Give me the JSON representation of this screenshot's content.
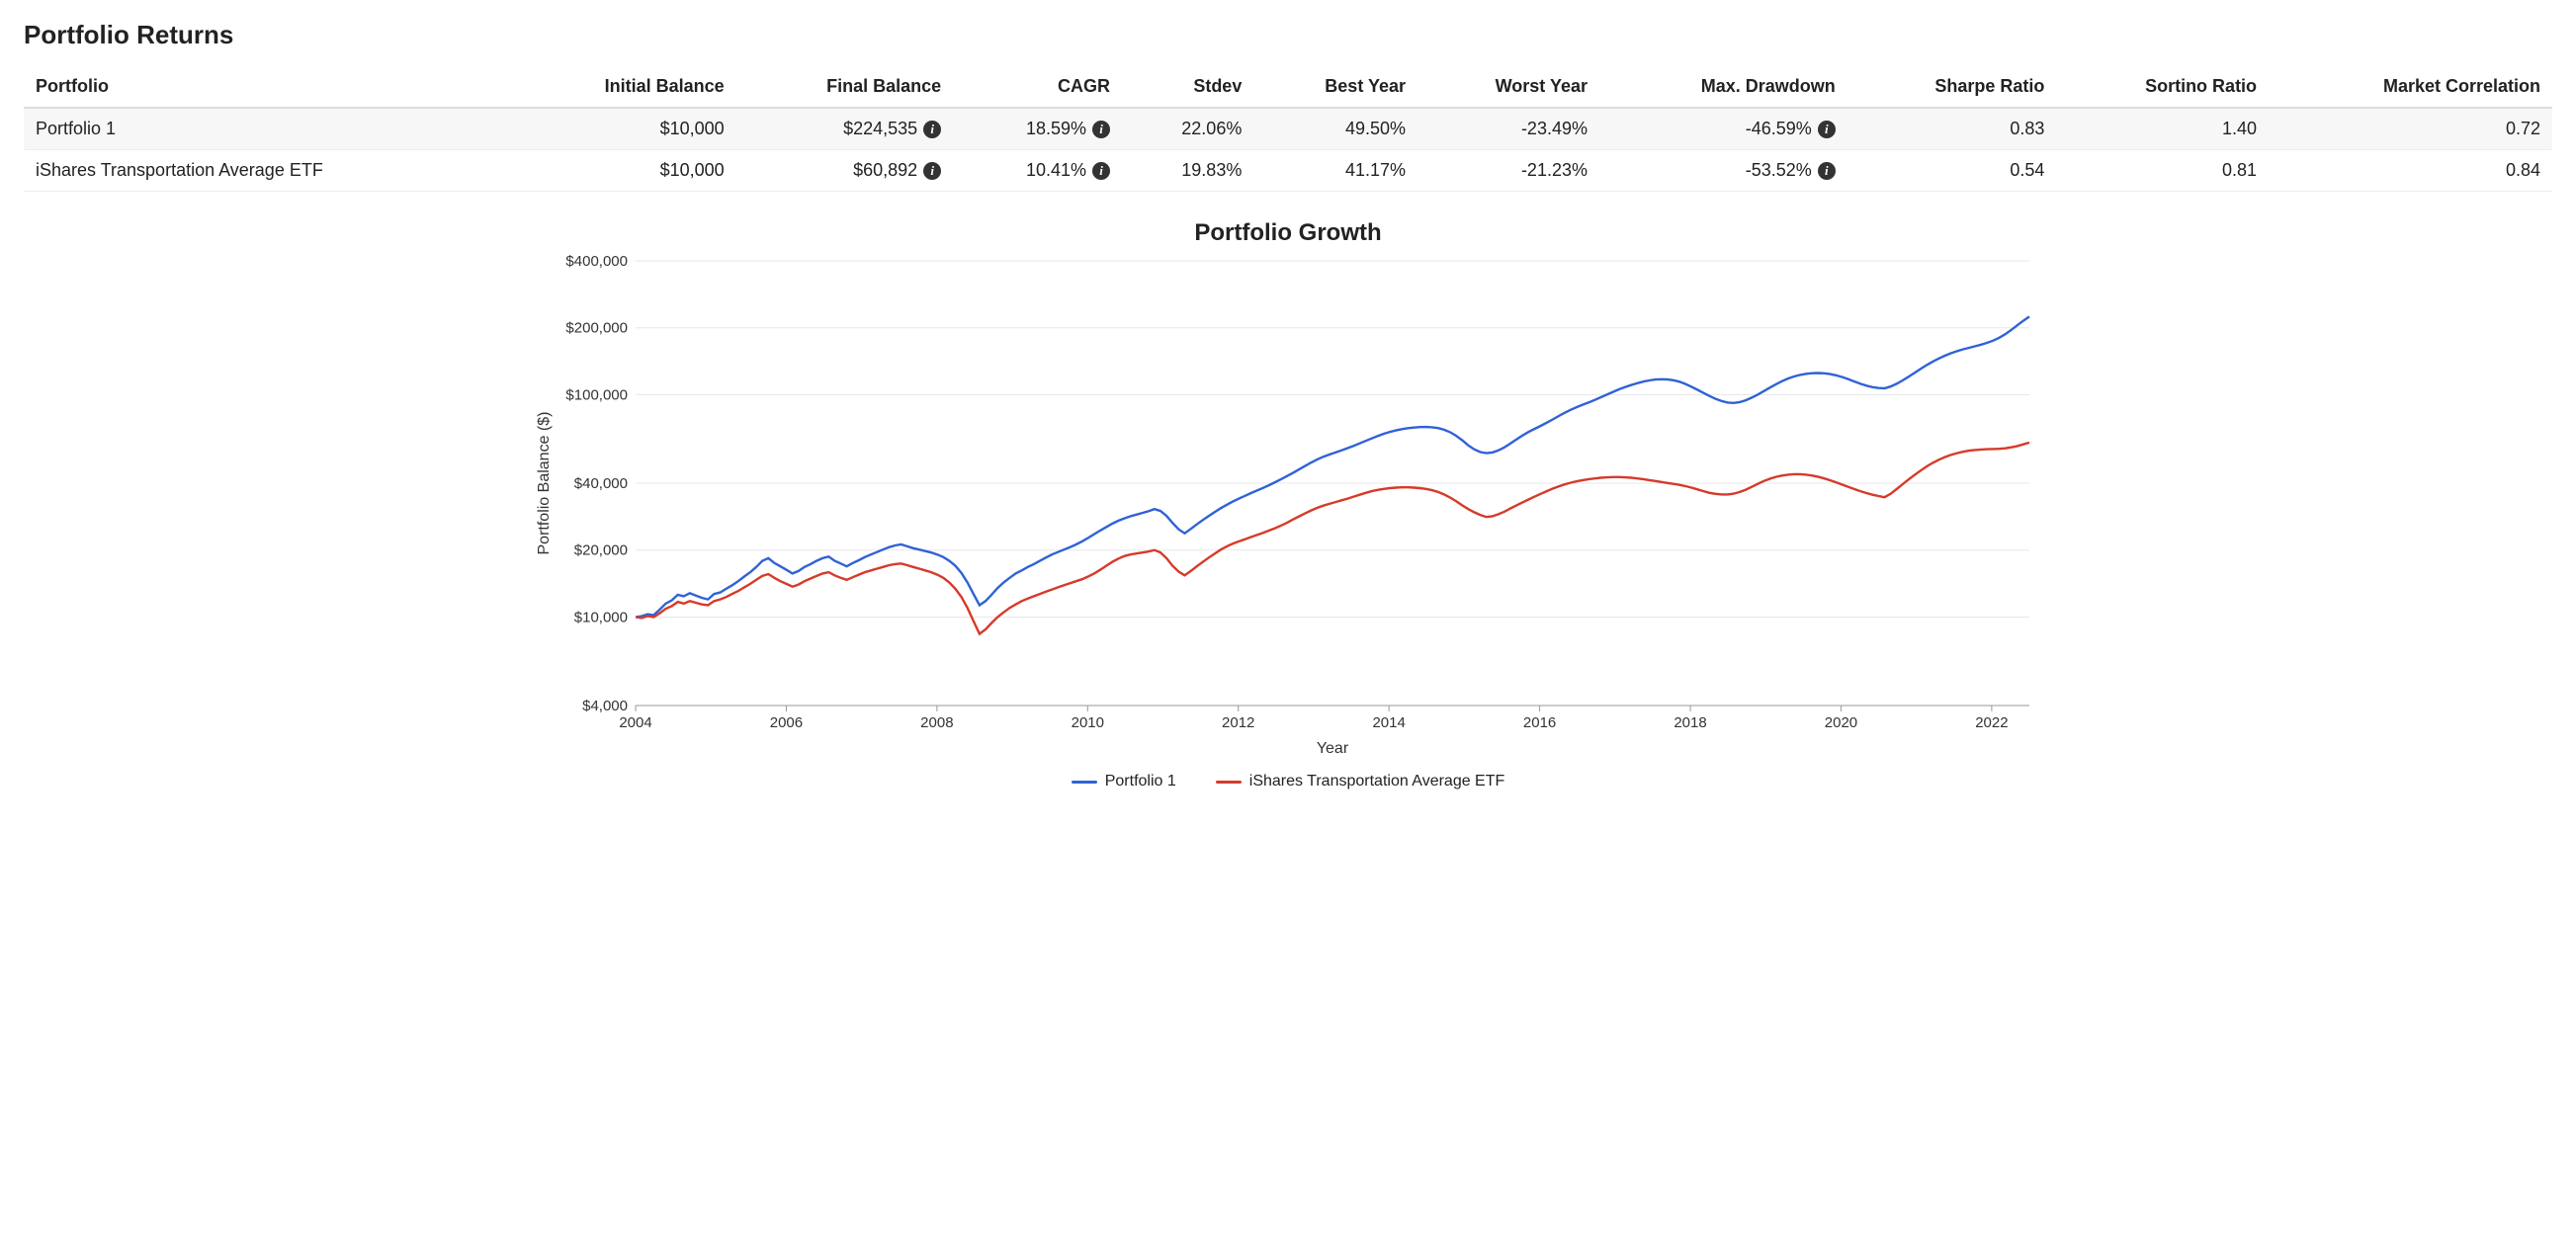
{
  "title": "Portfolio Returns",
  "table": {
    "headers": [
      "Portfolio",
      "Initial Balance",
      "Final Balance",
      "CAGR",
      "Stdev",
      "Best Year",
      "Worst Year",
      "Max. Drawdown",
      "Sharpe Ratio",
      "Sortino Ratio",
      "Market Correlation"
    ],
    "rows": [
      {
        "name": "Portfolio 1",
        "initial": "$10,000",
        "final": "$224,535",
        "cagr": "18.59%",
        "stdev": "22.06%",
        "best": "49.50%",
        "worst": "-23.49%",
        "maxdd": "-46.59%",
        "sharpe": "0.83",
        "sortino": "1.40",
        "corr": "0.72"
      },
      {
        "name": "iShares Transportation Average ETF",
        "initial": "$10,000",
        "final": "$60,892",
        "cagr": "10.41%",
        "stdev": "19.83%",
        "best": "41.17%",
        "worst": "-21.23%",
        "maxdd": "-53.52%",
        "sharpe": "0.54",
        "sortino": "0.81",
        "corr": "0.84"
      }
    ],
    "info_columns": [
      "final",
      "cagr",
      "maxdd"
    ]
  },
  "chart_data": {
    "type": "line",
    "title": "Portfolio Growth",
    "xlabel": "Year",
    "ylabel": "Portfolio Balance ($)",
    "x_start": 2004.0,
    "x_end": 2022.5,
    "x_ticks": [
      2004,
      2006,
      2008,
      2010,
      2012,
      2014,
      2016,
      2018,
      2020,
      2022
    ],
    "y_scale": "log",
    "y_ticks": [
      4000,
      10000,
      20000,
      40000,
      100000,
      200000,
      400000
    ],
    "y_tick_labels": [
      "$4,000",
      "$10,000",
      "$20,000",
      "$40,000",
      "$100,000",
      "$200,000",
      "$400,000"
    ],
    "ylim": [
      4000,
      400000
    ],
    "legend_position": "bottom",
    "series": [
      {
        "name": "Portfolio 1",
        "color": "#2f62d6",
        "values": [
          10000,
          10100,
          10300,
          10200,
          10800,
          11500,
          11900,
          12600,
          12400,
          12800,
          12500,
          12200,
          12000,
          12700,
          12900,
          13400,
          13900,
          14500,
          15200,
          15900,
          16800,
          17900,
          18400,
          17500,
          16900,
          16300,
          15700,
          16100,
          16800,
          17300,
          17900,
          18400,
          18700,
          17900,
          17400,
          16900,
          17500,
          18000,
          18600,
          19100,
          19600,
          20100,
          20600,
          21000,
          21200,
          20800,
          20400,
          20100,
          19800,
          19500,
          19100,
          18600,
          17900,
          17000,
          15800,
          14300,
          12700,
          11300,
          11800,
          12600,
          13500,
          14300,
          15000,
          15700,
          16200,
          16800,
          17300,
          17900,
          18500,
          19100,
          19600,
          20100,
          20600,
          21200,
          21900,
          22700,
          23600,
          24500,
          25400,
          26300,
          27100,
          27800,
          28400,
          28900,
          29400,
          29900,
          30600,
          30000,
          28500,
          26500,
          24800,
          23800,
          24900,
          26100,
          27300,
          28500,
          29700,
          30900,
          32000,
          33100,
          34100,
          35100,
          36100,
          37100,
          38100,
          39200,
          40400,
          41700,
          43100,
          44600,
          46200,
          47900,
          49600,
          51200,
          52600,
          53800,
          55000,
          56200,
          57500,
          58900,
          60400,
          62000,
          63600,
          65200,
          66700,
          68000,
          69100,
          70000,
          70700,
          71200,
          71500,
          71600,
          71400,
          70800,
          69600,
          67800,
          65400,
          62400,
          59200,
          56800,
          55200,
          54600,
          55000,
          56200,
          58000,
          60400,
          63000,
          65600,
          68000,
          70200,
          72400,
          74800,
          77400,
          80200,
          83000,
          85600,
          88000,
          90200,
          92400,
          94800,
          97400,
          100200,
          103000,
          105700,
          108200,
          110500,
          112600,
          114500,
          116000,
          117000,
          117400,
          117200,
          116200,
          114400,
          111800,
          108600,
          105200,
          101800,
          98600,
          95800,
          93600,
          92200,
          91800,
          92600,
          94400,
          97000,
          100200,
          103800,
          107600,
          111400,
          115000,
          118200,
          120800,
          122800,
          124200,
          125000,
          125200,
          124800,
          123800,
          122200,
          120000,
          117400,
          114600,
          112000,
          109800,
          108200,
          107200,
          106800,
          108800,
          112000,
          116000,
          120600,
          125600,
          130800,
          136000,
          141000,
          145600,
          149800,
          153600,
          157000,
          160000,
          162600,
          165200,
          168000,
          171200,
          175200,
          180400,
          187200,
          195600,
          205200,
          215200,
          224535
        ]
      },
      {
        "name": "iShares Transportation Average ETF",
        "color": "#d63a2a",
        "values": [
          10000,
          9900,
          10100,
          10000,
          10400,
          10900,
          11200,
          11700,
          11500,
          11800,
          11600,
          11400,
          11300,
          11800,
          12000,
          12300,
          12700,
          13100,
          13600,
          14100,
          14700,
          15300,
          15600,
          15000,
          14500,
          14100,
          13700,
          14000,
          14500,
          14900,
          15300,
          15700,
          15900,
          15400,
          15000,
          14700,
          15100,
          15500,
          15900,
          16200,
          16500,
          16800,
          17100,
          17300,
          17400,
          17100,
          16800,
          16500,
          16200,
          15900,
          15500,
          15000,
          14300,
          13400,
          12300,
          11000,
          9600,
          8400,
          8800,
          9400,
          10000,
          10500,
          11000,
          11400,
          11800,
          12100,
          12400,
          12700,
          13000,
          13300,
          13600,
          13900,
          14200,
          14500,
          14800,
          15200,
          15700,
          16300,
          17000,
          17700,
          18300,
          18800,
          19100,
          19300,
          19500,
          19700,
          20000,
          19500,
          18400,
          17000,
          16000,
          15400,
          16100,
          16900,
          17700,
          18500,
          19300,
          20100,
          20800,
          21400,
          21900,
          22400,
          22900,
          23400,
          23900,
          24500,
          25100,
          25800,
          26600,
          27500,
          28400,
          29300,
          30200,
          31000,
          31700,
          32300,
          32900,
          33500,
          34100,
          34800,
          35500,
          36200,
          36800,
          37300,
          37700,
          38000,
          38200,
          38300,
          38300,
          38200,
          38000,
          37700,
          37200,
          36500,
          35600,
          34500,
          33200,
          31800,
          30600,
          29600,
          28800,
          28200,
          28400,
          29000,
          29800,
          30800,
          31800,
          32800,
          33800,
          34800,
          35800,
          36800,
          37800,
          38700,
          39500,
          40200,
          40800,
          41300,
          41700,
          42000,
          42300,
          42500,
          42600,
          42600,
          42500,
          42300,
          42000,
          41700,
          41300,
          40900,
          40500,
          40100,
          39700,
          39300,
          38800,
          38200,
          37500,
          36800,
          36200,
          35800,
          35600,
          35600,
          35900,
          36500,
          37400,
          38500,
          39700,
          40900,
          41900,
          42700,
          43300,
          43700,
          43900,
          43900,
          43700,
          43300,
          42700,
          42000,
          41200,
          40300,
          39400,
          38500,
          37600,
          36800,
          36100,
          35500,
          35000,
          34600,
          35800,
          37600,
          39600,
          41600,
          43600,
          45600,
          47600,
          49400,
          51000,
          52400,
          53600,
          54600,
          55400,
          56000,
          56400,
          56700,
          56900,
          57000,
          57100,
          57400,
          58000,
          58800,
          59800,
          60892
        ]
      }
    ]
  }
}
